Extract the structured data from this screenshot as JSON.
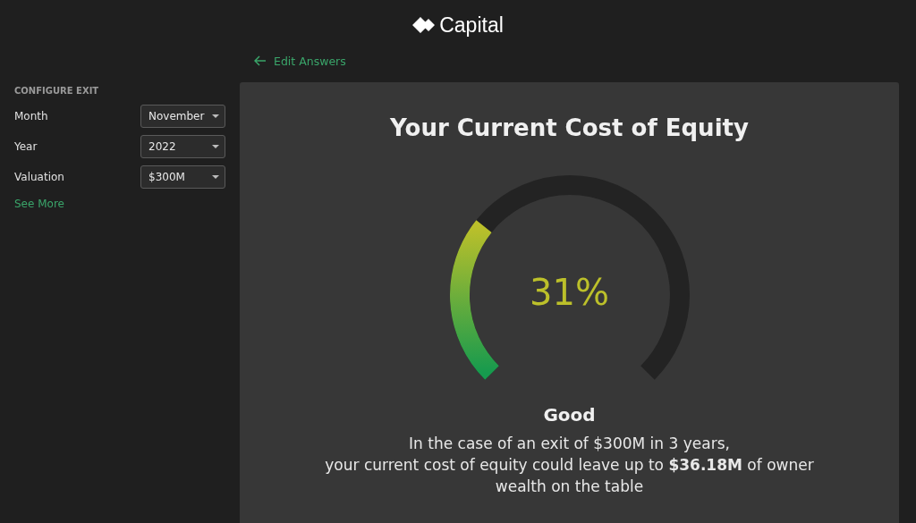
{
  "header": {
    "logo_text": "Capital"
  },
  "back_link": {
    "label": "Edit Answers"
  },
  "sidebar": {
    "heading": "CONFIGURE EXIT",
    "fields": [
      {
        "label": "Month",
        "value": "November"
      },
      {
        "label": "Year",
        "value": "2022"
      },
      {
        "label": "Valuation",
        "value": "$300M"
      }
    ],
    "more_link": "See More"
  },
  "result": {
    "title": "Your Current Cost of Equity",
    "gauge": {
      "reading": "31%"
    },
    "rating": "Good",
    "summary": [
      "In the case of an exit of $300M in 3 years,",
      "your current cost of equity could leave up to **$36.18M** of owner wealth on the table"
    ]
  }
}
